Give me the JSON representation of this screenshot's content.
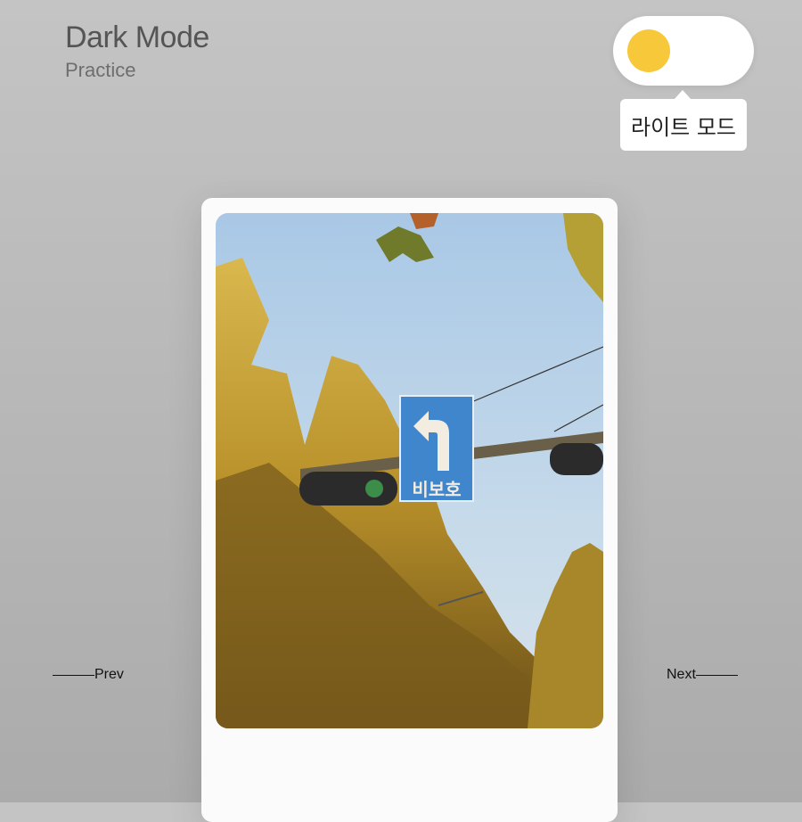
{
  "header": {
    "title": "Dark Mode",
    "subtitle": "Practice"
  },
  "theme_toggle": {
    "mode_label": "라이트 모드",
    "knob_color": "#f7c83a",
    "state": "light",
    "icon": "sun-knob"
  },
  "card": {
    "photo": {
      "sign_text": "비보호",
      "sign_color": "#3f86cc",
      "sign_icon": "left-turn-arrow-icon"
    }
  },
  "nav": {
    "prev_label": "Prev",
    "next_label": "Next"
  }
}
